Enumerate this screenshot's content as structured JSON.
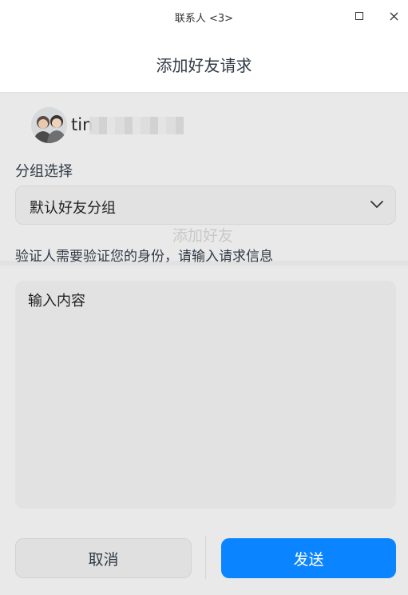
{
  "window": {
    "title": "联系人 <3>",
    "maximize_icon": "maximize-icon",
    "close_icon": "close-icon"
  },
  "dialog": {
    "title": "添加好友请求"
  },
  "user": {
    "name_visible": "tin",
    "avatar_icon": "avatar-image"
  },
  "group": {
    "label": "分组选择",
    "selected": "默认好友分组",
    "chevron_icon": "chevron-down-icon"
  },
  "verification": {
    "label": "验证人需要验证您的身份，请输入请求信息",
    "placeholder": "输入内容"
  },
  "actions": {
    "cancel_label": "取消",
    "send_label": "发送"
  },
  "background_ghost": {
    "text": "添加好友"
  },
  "colors": {
    "accent": "#0a84ff",
    "dialog_bg": "#e9e9e9",
    "field_bg": "#e2e2e2"
  }
}
